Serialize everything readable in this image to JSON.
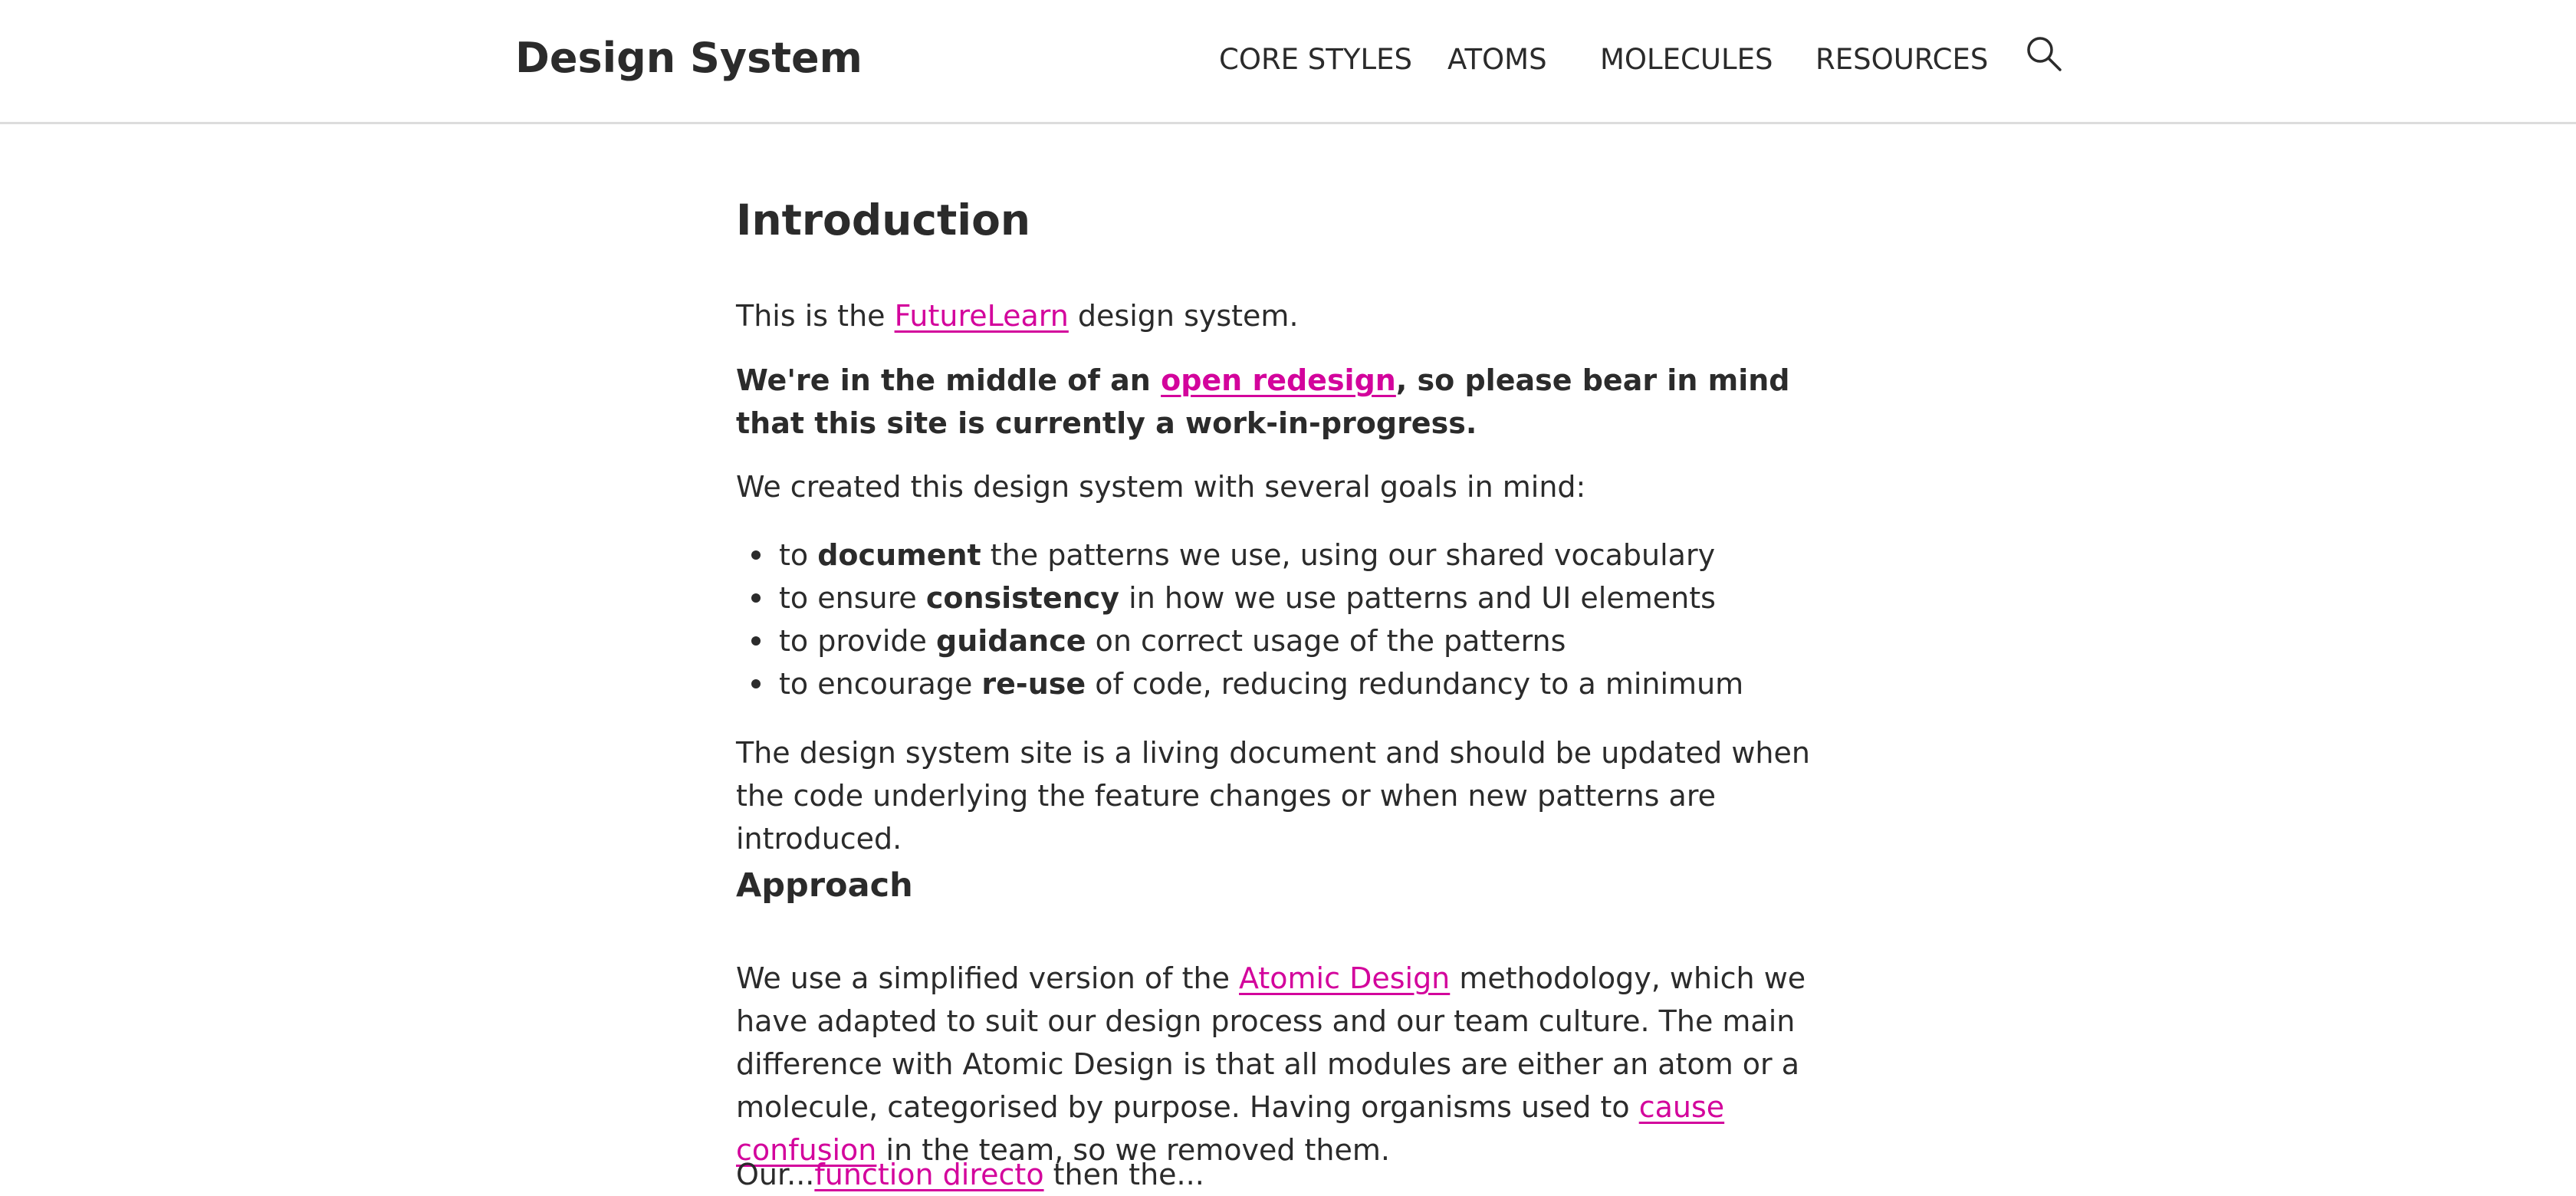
{
  "header": {
    "brand": "Design System",
    "nav": [
      "CORE STYLES",
      "ATOMS",
      "MOLECULES",
      "RESOURCES"
    ],
    "search_icon": "search-icon"
  },
  "main": {
    "title": "Introduction",
    "intro": {
      "before": "This is the ",
      "link": "FutureLearn",
      "after": " design system."
    },
    "notice": {
      "before": "We're in the middle of an ",
      "link": "open redesign",
      "after": ", so please bear in mind that this site is currently a work-in-progress."
    },
    "goals_intro": "We created this design system with several goals in mind:",
    "goals": [
      {
        "pre": "to ",
        "bold": "document",
        "post": " the patterns we use, using our shared vocabulary"
      },
      {
        "pre": "to ensure ",
        "bold": "consistency",
        "post": " in how we use patterns and UI elements"
      },
      {
        "pre": "to provide ",
        "bold": "guidance",
        "post": " on correct usage of the patterns"
      },
      {
        "pre": "to encourage ",
        "bold": "re-use",
        "post": " of code, reducing redundancy to a minimum"
      }
    ],
    "living": "The design system site is a living document and should be updated when the code underlying the feature changes or when new patterns are introduced.",
    "approach_heading": "Approach",
    "approach": {
      "before": "We use a simplified version of the ",
      "link1": "Atomic Design",
      "middle": " methodology, which we have adapted to suit our design process and our team culture. The main difference with Atomic Design is that all modules are either an atom or a molecule, categorised by purpose. Having organisms used to ",
      "link2": "cause confusion",
      "after": " in the team, so we removed them."
    },
    "cutoff": {
      "before": "Our...",
      "link": "function directo",
      "after": " then the..."
    }
  },
  "colors": {
    "link": "#d3049c",
    "text": "#2b2b2b",
    "divider": "#dcdcdc"
  }
}
